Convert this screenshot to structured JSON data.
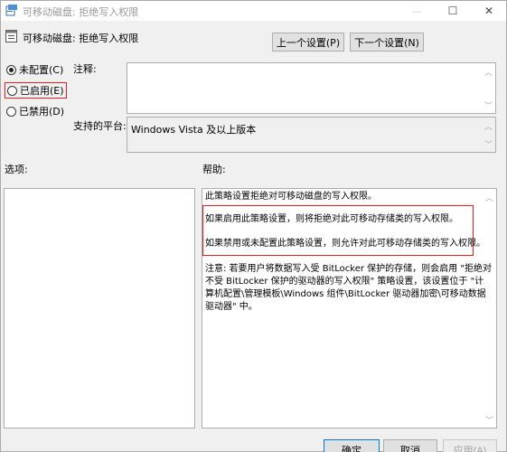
{
  "window": {
    "title": "可移动磁盘: 拒绝写入权限",
    "minimize": "—",
    "maximize": "☐",
    "close": "✕"
  },
  "header": {
    "policy_name": "可移动磁盘: 拒绝写入权限",
    "prev_label": "上一个设置(P)",
    "next_label": "下一个设置(N)"
  },
  "options": {
    "not_configured": "未配置(C)",
    "enabled": "已启用(E)",
    "disabled": "已禁用(D)",
    "selected": "not_configured"
  },
  "comment": {
    "label": "注释:",
    "value": ""
  },
  "platform": {
    "label": "支持的平台:",
    "value": "Windows Vista 及以上版本"
  },
  "sections": {
    "options_label": "选项:",
    "help_label": "帮助:"
  },
  "help": {
    "para1": "此策略设置拒绝对可移动磁盘的写入权限。",
    "para2": "如果启用此策略设置，则将拒绝对此可移动存储类的写入权限。",
    "para3": "如果禁用或未配置此策略设置，则允许对此可移动存储类的写入权限。",
    "note_line1": "注意: 若要用户将数据写入受 BitLocker 保护的存储，则会启用 \"拒绝对",
    "note_line2": "不受 BitLocker 保护的驱动器的写入权限\" 策略设置，该设置位于 \"计",
    "note_line3": "算机配置\\管理模板\\Windows 组件\\BitLocker 驱动器加密\\可移动数据",
    "note_line4": "驱动器\" 中。"
  },
  "footer": {
    "ok_label": "确定",
    "cancel_label": "取消",
    "apply_label": "应用(A)"
  }
}
